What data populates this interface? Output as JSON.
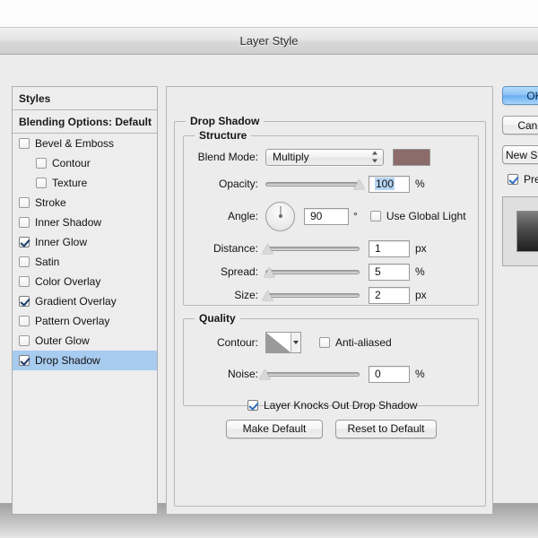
{
  "window": {
    "title": "Layer Style"
  },
  "styles_panel": {
    "header": "Styles",
    "blending_options": "Blending Options: Default",
    "items": [
      {
        "label": "Bevel & Emboss",
        "checked": false,
        "indent": false,
        "selected": false
      },
      {
        "label": "Contour",
        "checked": false,
        "indent": true,
        "selected": false
      },
      {
        "label": "Texture",
        "checked": false,
        "indent": true,
        "selected": false
      },
      {
        "label": "Stroke",
        "checked": false,
        "indent": false,
        "selected": false
      },
      {
        "label": "Inner Shadow",
        "checked": false,
        "indent": false,
        "selected": false
      },
      {
        "label": "Inner Glow",
        "checked": true,
        "indent": false,
        "selected": false
      },
      {
        "label": "Satin",
        "checked": false,
        "indent": false,
        "selected": false
      },
      {
        "label": "Color Overlay",
        "checked": false,
        "indent": false,
        "selected": false
      },
      {
        "label": "Gradient Overlay",
        "checked": true,
        "indent": false,
        "selected": false
      },
      {
        "label": "Pattern Overlay",
        "checked": false,
        "indent": false,
        "selected": false
      },
      {
        "label": "Outer Glow",
        "checked": false,
        "indent": false,
        "selected": false
      },
      {
        "label": "Drop Shadow",
        "checked": true,
        "indent": false,
        "selected": true
      }
    ]
  },
  "effect_panel": {
    "title": "Drop Shadow",
    "structure": {
      "title": "Structure",
      "blend_mode_label": "Blend Mode:",
      "blend_mode_value": "Multiply",
      "shadow_color": "#8c6b6b",
      "opacity_label": "Opacity:",
      "opacity_value": "100",
      "opacity_unit": "%",
      "opacity_percent": 100,
      "angle_label": "Angle:",
      "angle_value": "90",
      "angle_unit": "°",
      "use_global_light_label": "Use Global Light",
      "use_global_light_checked": false,
      "distance_label": "Distance:",
      "distance_value": "1",
      "distance_unit": "px",
      "distance_percent": 3,
      "spread_label": "Spread:",
      "spread_value": "5",
      "spread_unit": "%",
      "spread_percent": 5,
      "size_label": "Size:",
      "size_value": "2",
      "size_unit": "px",
      "size_percent": 3
    },
    "quality": {
      "title": "Quality",
      "contour_label": "Contour:",
      "anti_aliased_label": "Anti-aliased",
      "anti_aliased_checked": false,
      "noise_label": "Noise:",
      "noise_value": "0",
      "noise_unit": "%",
      "noise_percent": 0
    },
    "knockout_label": "Layer Knocks Out Drop Shadow",
    "knockout_checked": true,
    "make_default_label": "Make Default",
    "reset_default_label": "Reset to Default"
  },
  "actions": {
    "ok_label": "OK",
    "cancel_label": "Cancel",
    "new_style_label": "New Style...",
    "preview_label": "Preview",
    "preview_checked": true
  }
}
